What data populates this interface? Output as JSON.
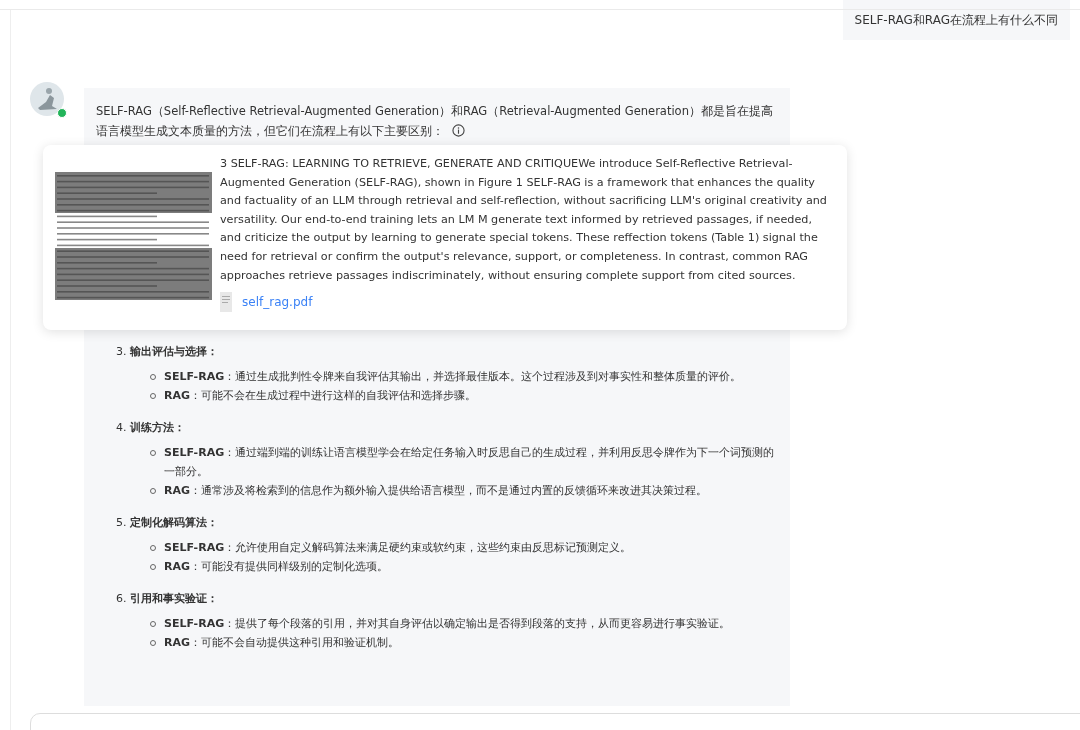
{
  "user_message": {
    "text": "SELF-RAG和RAG在流程上有什么不同"
  },
  "assistant": {
    "online": true,
    "intro": "SELF-RAG（Self-Reflective Retrieval-Augmented Generation）和RAG（Retrieval-Augmented Generation）都是旨在提高语言模型生成文本质量的方法，但它们在流程上有以下主要区别：",
    "sections": [
      {
        "number": "3.",
        "title": "输出评估与选择：",
        "points": [
          {
            "term": "SELF-RAG",
            "text": "：通过生成批判性令牌来自我评估其输出，并选择最佳版本。这个过程涉及到对事实性和整体质量的评价。"
          },
          {
            "term": "RAG",
            "text": "：可能不会在生成过程中进行这样的自我评估和选择步骤。"
          }
        ]
      },
      {
        "number": "4.",
        "title": "训练方法：",
        "points": [
          {
            "term": "SELF-RAG",
            "text": "：通过端到端的训练让语言模型学会在给定任务输入时反思自己的生成过程，并利用反思令牌作为下一个词预测的一部分。"
          },
          {
            "term": "RAG",
            "text": "：通常涉及将检索到的信息作为额外输入提供给语言模型，而不是通过内置的反馈循环来改进其决策过程。"
          }
        ]
      },
      {
        "number": "5.",
        "title": "定制化解码算法：",
        "points": [
          {
            "term": "SELF-RAG",
            "text": "：允许使用自定义解码算法来满足硬约束或软约束，这些约束由反思标记预测定义。"
          },
          {
            "term": "RAG",
            "text": "：可能没有提供同样级别的定制化选项。"
          }
        ]
      },
      {
        "number": "6.",
        "title": "引用和事实验证：",
        "points": [
          {
            "term": "SELF-RAG",
            "text": "：提供了每个段落的引用，并对其自身评估以确定输出是否得到段落的支持，从而更容易进行事实验证。"
          },
          {
            "term": "RAG",
            "text": "：可能不会自动提供这种引用和验证机制。"
          }
        ]
      }
    ]
  },
  "citation_popover": {
    "excerpt": "3 SELF-RAG: LEARNING TO RETRIEVE, GENERATE AND CRITIQUEWe introduce Self-Reflective Retrieval-Augmented Generation (SELF-RAG), shown in Figure 1 SELF-RAG is a framework that enhances the quality and factuality of an LLM through retrieval and self-reflection, without sacrificing LLM's original creativity and versatility. Our end-to-end training lets an LM M generate text informed by retrieved passages, if needed, and criticize the output by learning to generate special tokens. These reffection tokens (Table 1) signal the need for retrieval or confirm the output's relevance, support, or completeness. In contrast, common RAG approaches retrieve passages indiscriminately, without ensuring complete support from cited sources.",
    "file_name": "self_rag.pdf"
  }
}
